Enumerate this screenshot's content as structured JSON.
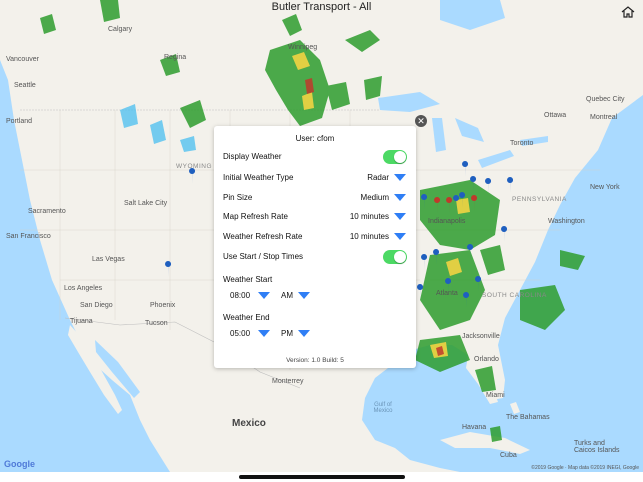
{
  "window": {
    "title": "Butler Transport - All"
  },
  "icons": {
    "home": "home-icon",
    "close": "close-icon",
    "dropdown": "chevron-down-icon",
    "pin": "map-pin-icon"
  },
  "colors": {
    "accent": "#2f7ef5",
    "toggle_on": "#4cd964",
    "pin_blue": "#1f5fbf",
    "pin_red": "#c0392b"
  },
  "map": {
    "labels": {
      "calgary": "Calgary",
      "vancouver": "Vancouver",
      "regina": "Regina",
      "winnipeg": "Winnipeg",
      "seattle": "Seattle",
      "portland": "Portland",
      "wyoming": "WYOMING",
      "salt_lake": "Salt Lake City",
      "sacramento": "Sacramento",
      "san_francisco": "San Francisco",
      "las_vegas": "Las Vegas",
      "los_angeles": "Los Angeles",
      "san_diego": "San Diego",
      "phoenix": "Phoenix",
      "tucson": "Tucson",
      "tijuana": "Tijuana",
      "mexico": "Mexico",
      "monterrey": "Monterrey",
      "toronto": "Toronto",
      "ottawa": "Ottawa",
      "montreal": "Montreal",
      "quebec_city": "Quebec City",
      "indianapolis": "Indianapolis",
      "pennsylvania": "PENNSYLVANIA",
      "new_york": "New York",
      "washington": "Washington",
      "atlanta": "Atlanta",
      "south_carolina": "SOUTH CAROLINA",
      "jacksonville": "Jacksonville",
      "orlando": "Orlando",
      "miami": "Miami",
      "gulf_of_mexico": "Gulf of Mexico",
      "havana": "Havana",
      "the_bahamas": "The Bahamas",
      "turks_caicos": "Turks and Caicos Islands",
      "cuba": "Cuba"
    },
    "google": "Google",
    "copyright": "©2019 Google · Map data ©2019 INEGI, Google"
  },
  "panel": {
    "user": "User: cfom",
    "display_weather": {
      "label": "Display Weather",
      "on": true
    },
    "initial_type": {
      "label": "Initial Weather Type",
      "value": "Radar"
    },
    "pin_size": {
      "label": "Pin Size",
      "value": "Medium"
    },
    "map_refresh": {
      "label": "Map Refresh Rate",
      "value": "10 minutes"
    },
    "weather_refresh": {
      "label": "Weather Refresh Rate",
      "value": "10 minutes"
    },
    "start_stop": {
      "label": "Use Start / Stop Times",
      "on": true
    },
    "weather_start": {
      "label": "Weather Start",
      "time": "08:00",
      "ampm": "AM"
    },
    "weather_end": {
      "label": "Weather End",
      "time": "05:00",
      "ampm": "PM"
    },
    "version": "Version: 1.0  Build: 5"
  }
}
